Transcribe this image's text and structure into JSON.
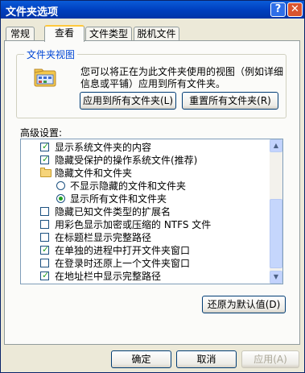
{
  "window": {
    "title": "文件夹选项",
    "help_glyph": "?",
    "close_glyph": "✕"
  },
  "tabs": [
    {
      "label": "常规",
      "active": false
    },
    {
      "label": "查看",
      "active": true
    },
    {
      "label": "文件类型",
      "active": false
    },
    {
      "label": "脱机文件",
      "active": false
    }
  ],
  "folder_views": {
    "title": "文件夹视图",
    "description": "您可以将正在为此文件夹使用的视图（例如详细信息或平铺）应用到所有文件夹。",
    "apply_all_button": "应用到所有文件夹(L)",
    "reset_all_button": "重置所有文件夹(R)"
  },
  "advanced": {
    "label": "高级设置:",
    "items": [
      {
        "type": "checkbox",
        "checked": true,
        "indent": 0,
        "label": "显示系统文件夹的内容"
      },
      {
        "type": "checkbox",
        "checked": true,
        "indent": 0,
        "label": "隐藏受保护的操作系统文件(推荐)"
      },
      {
        "type": "folder",
        "indent": 0,
        "label": "隐藏文件和文件夹"
      },
      {
        "type": "radio",
        "checked": false,
        "indent": 1,
        "label": "不显示隐藏的文件和文件夹"
      },
      {
        "type": "radio",
        "checked": true,
        "indent": 1,
        "label": "显示所有文件和文件夹"
      },
      {
        "type": "checkbox",
        "checked": false,
        "indent": 0,
        "label": "隐藏已知文件类型的扩展名"
      },
      {
        "type": "checkbox",
        "checked": false,
        "indent": 0,
        "label": "用彩色显示加密或压缩的 NTFS 文件"
      },
      {
        "type": "checkbox",
        "checked": false,
        "indent": 0,
        "label": "在标题栏显示完整路径"
      },
      {
        "type": "checkbox",
        "checked": true,
        "indent": 0,
        "label": "在单独的进程中打开文件夹窗口"
      },
      {
        "type": "checkbox",
        "checked": false,
        "indent": 0,
        "label": "在登录时还原上一个文件夹窗口"
      },
      {
        "type": "checkbox",
        "checked": true,
        "indent": 0,
        "label": "在地址栏中显示完整路径"
      }
    ],
    "restore_defaults_button": "还原为默认值(D)"
  },
  "footer": {
    "ok": "确定",
    "cancel": "取消",
    "apply": "应用(A)"
  }
}
